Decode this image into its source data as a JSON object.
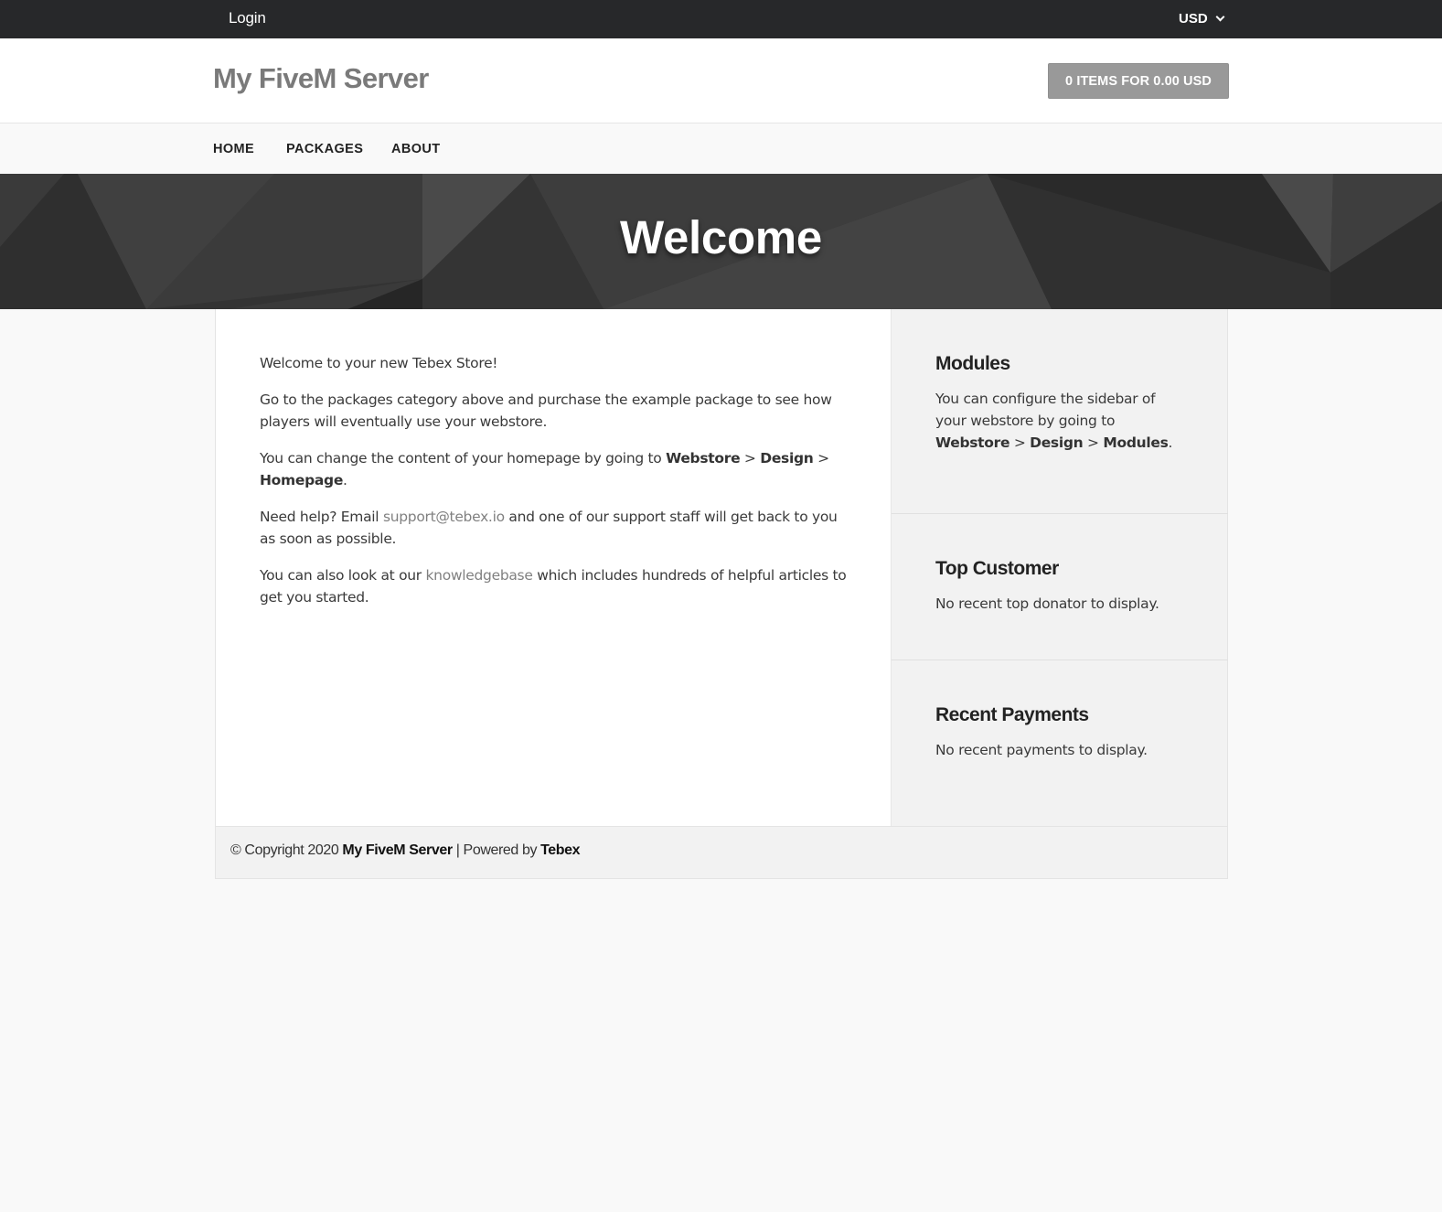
{
  "topbar": {
    "login_label": "Login",
    "currency": "USD"
  },
  "header": {
    "site_title": "My FiveM Server",
    "cart_label": "0 ITEMS FOR 0.00 USD"
  },
  "nav": {
    "items": [
      {
        "label": "HOME"
      },
      {
        "label": "PACKAGES"
      },
      {
        "label": "ABOUT"
      }
    ]
  },
  "hero": {
    "title": "Welcome"
  },
  "content": {
    "p1": "Welcome to your new Tebex Store!",
    "p2": "Go to the packages category above and purchase the example package to see how players will eventually use your webstore.",
    "p3_text": "You can change the content of your homepage by going to ",
    "p3_bold1": "Webstore",
    "p3_sep1": " > ",
    "p3_bold2": "Design",
    "p3_sep2": " > ",
    "p3_bold3": "Homepage",
    "p3_end": ".",
    "p4_text": "Need help? Email ",
    "p4_link": "support@tebex.io",
    "p4_end": " and one of our support staff will get back to you as soon as possible.",
    "p5_text": "You can also look at our ",
    "p5_link": "knowledgebase",
    "p5_end": " which includes hundreds of helpful articles to get you started."
  },
  "sidebar": {
    "modules": {
      "title": "Modules",
      "text": "You can configure the sidebar of your webstore by going to ",
      "bold1": "Webstore",
      "sep1": " > ",
      "bold2": "Design",
      "sep2": " > ",
      "bold3": "Modules",
      "end": "."
    },
    "top_customer": {
      "title": "Top Customer",
      "text": "No recent top donator to display."
    },
    "recent_payments": {
      "title": "Recent Payments",
      "text": "No recent payments to display."
    }
  },
  "footer": {
    "copyright": "© Copyright 2020 ",
    "site_name": "My FiveM Server",
    "powered": " | Powered by ",
    "brand": "Tebex"
  },
  "colors": {
    "topbar_bg": "#27282a",
    "cart_button_bg": "#999999",
    "link_color": "#808080",
    "sidebar_bg": "#f2f2f2"
  }
}
